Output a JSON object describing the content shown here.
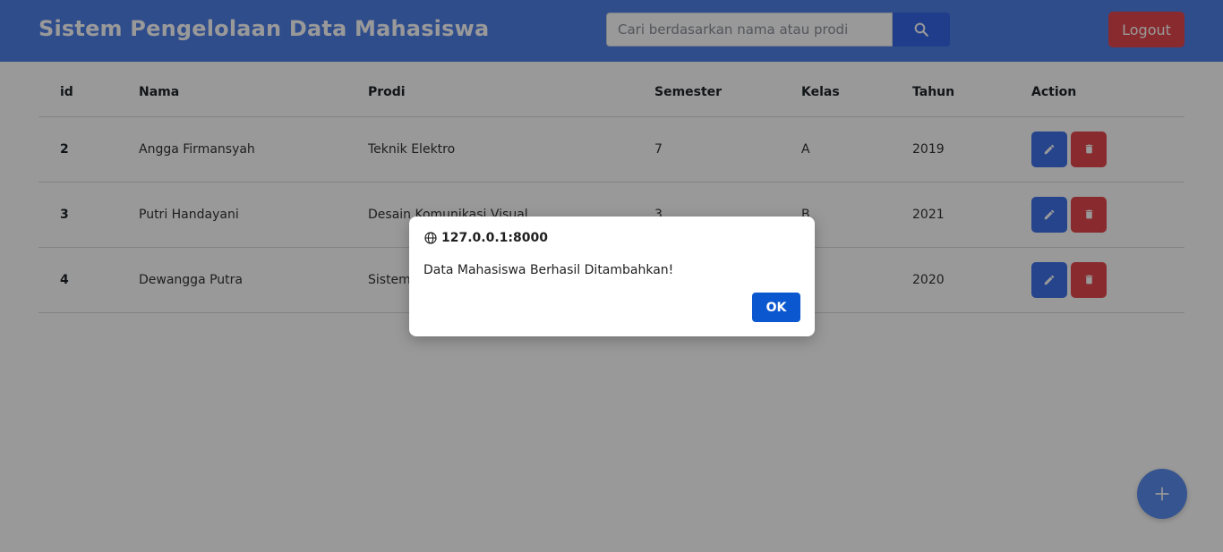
{
  "header": {
    "title": "Sistem Pengelolaan Data Mahasiswa",
    "search_placeholder": "Cari berdasarkan nama atau prodi",
    "search_icon": "search-icon",
    "logout_label": "Logout"
  },
  "table": {
    "columns": [
      "id",
      "Nama",
      "Prodi",
      "Semester",
      "Kelas",
      "Tahun",
      "Action"
    ],
    "rows": [
      {
        "id": "2",
        "nama": "Angga Firmansyah",
        "prodi": "Teknik Elektro",
        "semester": "7",
        "kelas": "A",
        "tahun": "2019"
      },
      {
        "id": "3",
        "nama": "Putri Handayani",
        "prodi": "Desain Komunikasi Visual",
        "semester": "3",
        "kelas": "B",
        "tahun": "2021"
      },
      {
        "id": "4",
        "nama": "Dewangga Putra",
        "prodi": "Sistem",
        "semester": "",
        "kelas": "",
        "tahun": "2020"
      }
    ],
    "action_icons": [
      "pencil-icon",
      "trash-icon"
    ]
  },
  "fab": {
    "icon": "plus-icon"
  },
  "dialog": {
    "origin": "127.0.0.1:8000",
    "message": "Data Mahasiswa Berhasil Ditambahkan!",
    "ok_label": "OK"
  },
  "colors": {
    "header": "#4f7fe8",
    "primary": "#3f72e8",
    "danger": "#e5484d",
    "dialog_button": "#0b57d0"
  }
}
